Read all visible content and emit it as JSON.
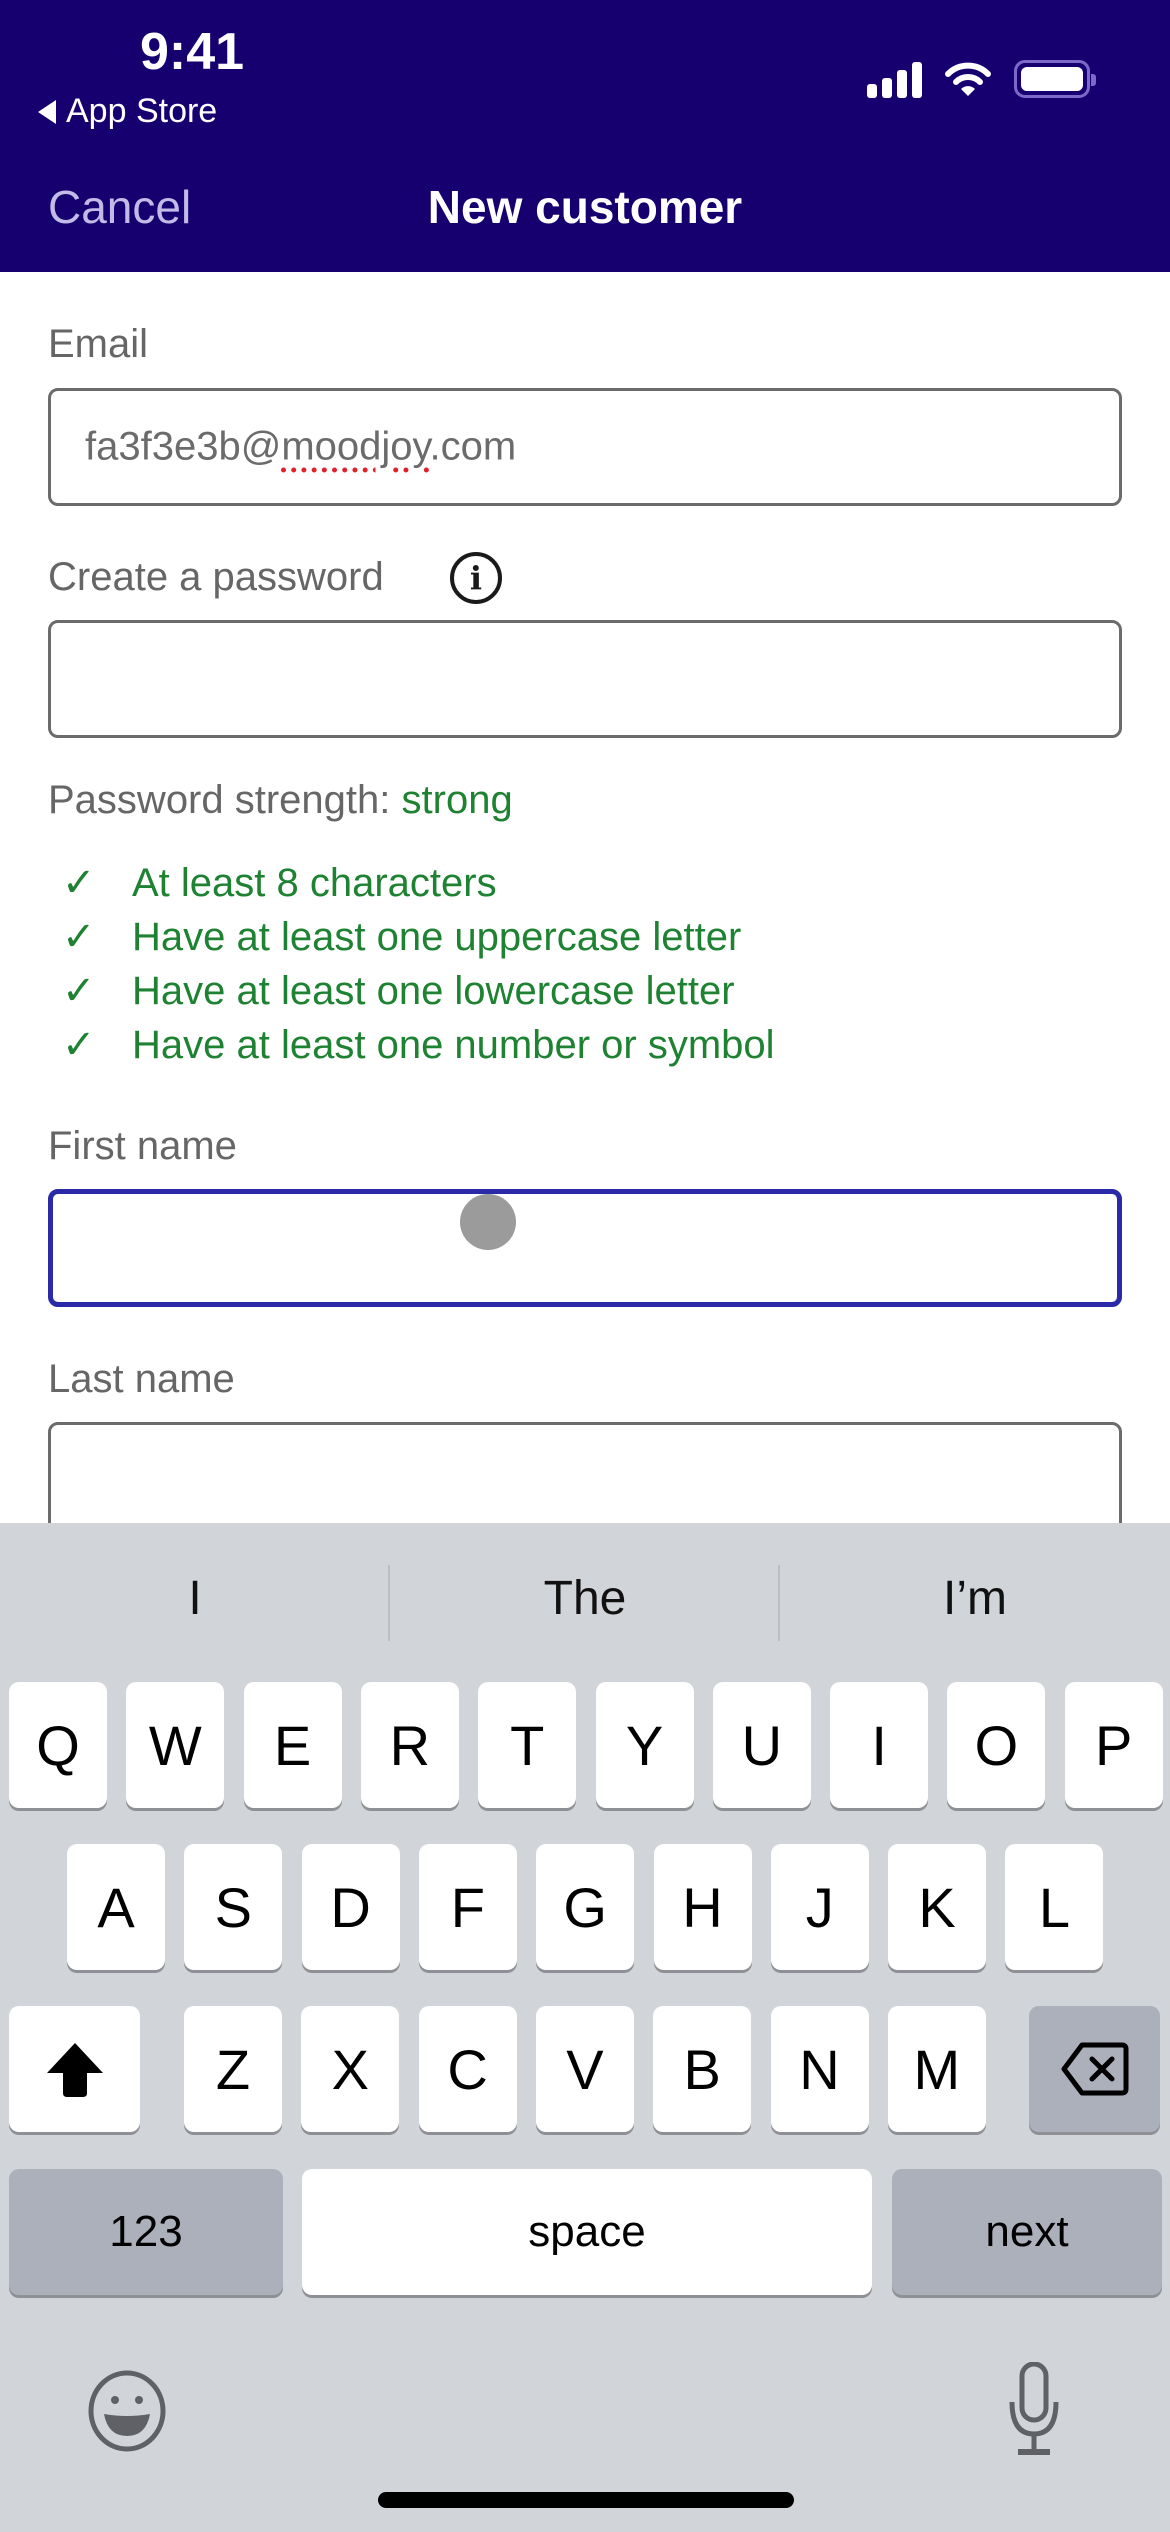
{
  "status_bar": {
    "time": "9:41",
    "back_app_label": "App Store",
    "icons": [
      "cellular-signal-icon",
      "wifi-icon",
      "battery-icon"
    ]
  },
  "nav": {
    "cancel_label": "Cancel",
    "title": "New customer",
    "background_color": "#16006f"
  },
  "form": {
    "email": {
      "label": "Email",
      "value_prefix": "fa3f3e3b@",
      "value_misspelled": "moodjoy",
      "value_suffix": ".com",
      "value": "fa3f3e3b@moodjoy.com"
    },
    "password": {
      "label": "Create a password",
      "info_icon": "info-icon",
      "value": ""
    },
    "strength": {
      "label": "Password strength:",
      "value": "strong",
      "color": "#1e8232"
    },
    "requirements": [
      {
        "text": "At least 8 characters",
        "met": true
      },
      {
        "text": "Have at least one uppercase letter",
        "met": true
      },
      {
        "text": "Have at least one lowercase letter",
        "met": true
      },
      {
        "text": "Have at least one number or symbol",
        "met": true
      }
    ],
    "check_glyph": "✓",
    "first_name": {
      "label": "First name",
      "value": "",
      "focused": true
    },
    "last_name": {
      "label": "Last name",
      "value": ""
    }
  },
  "keyboard": {
    "suggestions": [
      "I",
      "The",
      "I’m"
    ],
    "row1": [
      "Q",
      "W",
      "E",
      "R",
      "T",
      "Y",
      "U",
      "I",
      "O",
      "P"
    ],
    "row2": [
      "A",
      "S",
      "D",
      "F",
      "G",
      "H",
      "J",
      "K",
      "L"
    ],
    "row3": [
      "Z",
      "X",
      "C",
      "V",
      "B",
      "N",
      "M"
    ],
    "shift_icon": "shift-icon",
    "delete_icon": "delete-icon",
    "numbers_label": "123",
    "space_label": "space",
    "return_label": "next",
    "emoji_icon": "emoji-icon",
    "mic_icon": "microphone-icon"
  }
}
